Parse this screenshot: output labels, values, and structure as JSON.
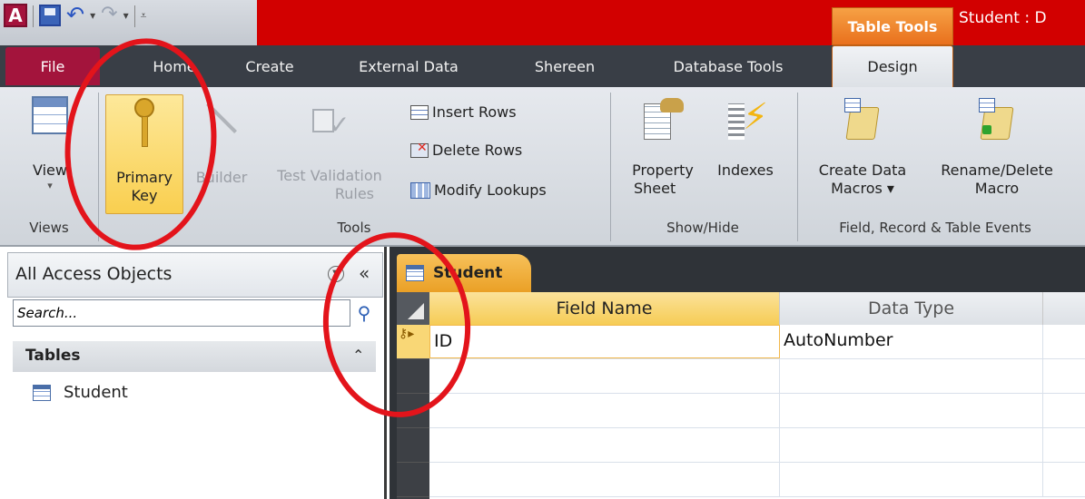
{
  "titlebar": {
    "app_icon_letter": "A",
    "contextual_group": "Table Tools",
    "window_title": "Student : D"
  },
  "tabs": [
    {
      "label": "File"
    },
    {
      "label": "Home"
    },
    {
      "label": "Create"
    },
    {
      "label": "External Data"
    },
    {
      "label": "Shereen"
    },
    {
      "label": "Database Tools"
    },
    {
      "label": "Design"
    }
  ],
  "ribbon": {
    "groups": {
      "views": "Views",
      "tools": "Tools",
      "showhide": "Show/Hide",
      "events": "Field, Record & Table Events"
    },
    "buttons": {
      "view": "View",
      "view_arrow": "▾",
      "primary_key_1": "Primary",
      "primary_key_2": "Key",
      "builder": "Builder",
      "test_validation_1": "Test Validation",
      "test_validation_2": "Rules",
      "insert_rows": "Insert Rows",
      "delete_rows": "Delete Rows",
      "modify_lookups": "Modify Lookups",
      "property_sheet_1": "Property",
      "property_sheet_2": "Sheet",
      "indexes": "Indexes",
      "create_data_macros_1": "Create Data",
      "create_data_macros_2": "Macros ▾",
      "rename_delete_macro_1": "Rename/Delete",
      "rename_delete_macro_2": "Macro"
    }
  },
  "nav": {
    "title": "All Access Objects",
    "collapse_glyph": "«",
    "search_placeholder": "Search...",
    "group_label": "Tables",
    "group_chevron": "⌃",
    "items": [
      {
        "label": "Student"
      }
    ]
  },
  "document": {
    "tab_label": "Student",
    "columns": [
      "Field Name",
      "Data Type"
    ],
    "rows": [
      {
        "field": "ID",
        "type": "AutoNumber",
        "primary_key": true
      },
      {
        "field": "",
        "type": ""
      },
      {
        "field": "",
        "type": ""
      },
      {
        "field": "",
        "type": ""
      },
      {
        "field": "",
        "type": ""
      }
    ]
  },
  "colors": {
    "title_bar": "#d20000",
    "file_tab": "#a3143c",
    "contextual_tab": "#e9701d",
    "highlight": "#f9cf4f",
    "annotation": "#e3141b"
  }
}
